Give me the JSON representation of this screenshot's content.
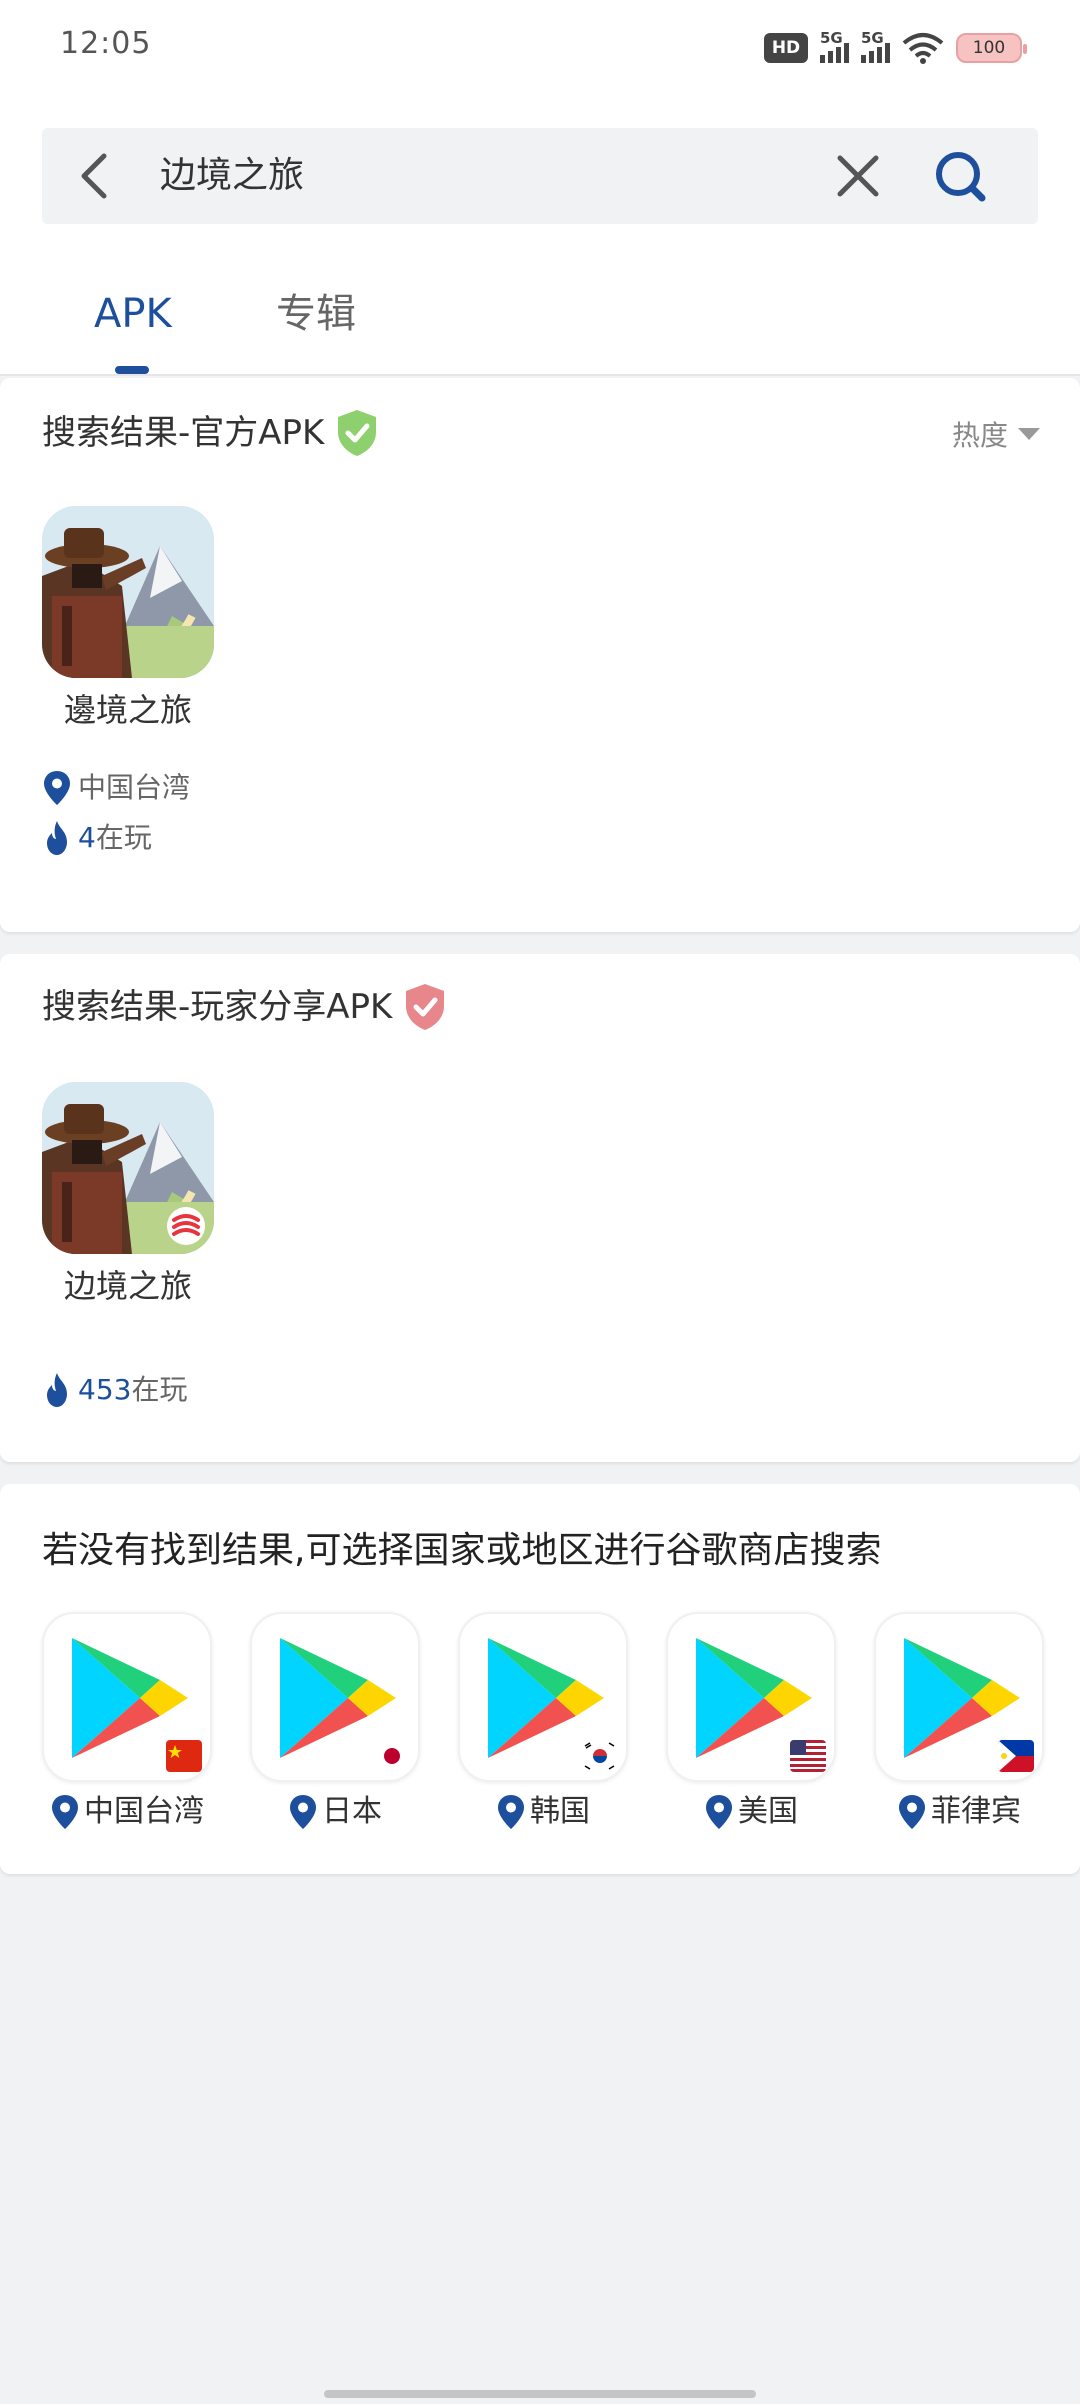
{
  "status": {
    "time": "12:05",
    "hd": "HD",
    "sim1": "5G",
    "sim2": "5G",
    "battery": "100"
  },
  "search": {
    "query": "边境之旅"
  },
  "tabs": [
    {
      "label": "APK"
    },
    {
      "label": "专辑"
    }
  ],
  "official": {
    "title": "搜索结果-官方APK",
    "sort_label": "热度",
    "app": {
      "name": "邊境之旅",
      "region": "中国台湾",
      "players": "4",
      "players_suffix": "在玩"
    }
  },
  "shared": {
    "title": "搜索结果-玩家分享APK",
    "app": {
      "name": "边境之旅",
      "players": "453",
      "players_suffix": "在玩"
    }
  },
  "google_play": {
    "title": "若没有找到结果,可选择国家或地区进行谷歌商店搜索",
    "stores": [
      {
        "label": "中国台湾",
        "flag": "taiwan-flag"
      },
      {
        "label": "日本",
        "flag": "japan-flag"
      },
      {
        "label": "韩国",
        "flag": "korea-flag"
      },
      {
        "label": "美国",
        "flag": "usa-flag"
      },
      {
        "label": "菲律宾",
        "flag": "philippines-flag"
      }
    ]
  },
  "colors": {
    "accent": "#1d4f9c",
    "official_shield": "#8fd06e",
    "shared_shield": "#e7868b",
    "background": "#f1f2f4"
  }
}
